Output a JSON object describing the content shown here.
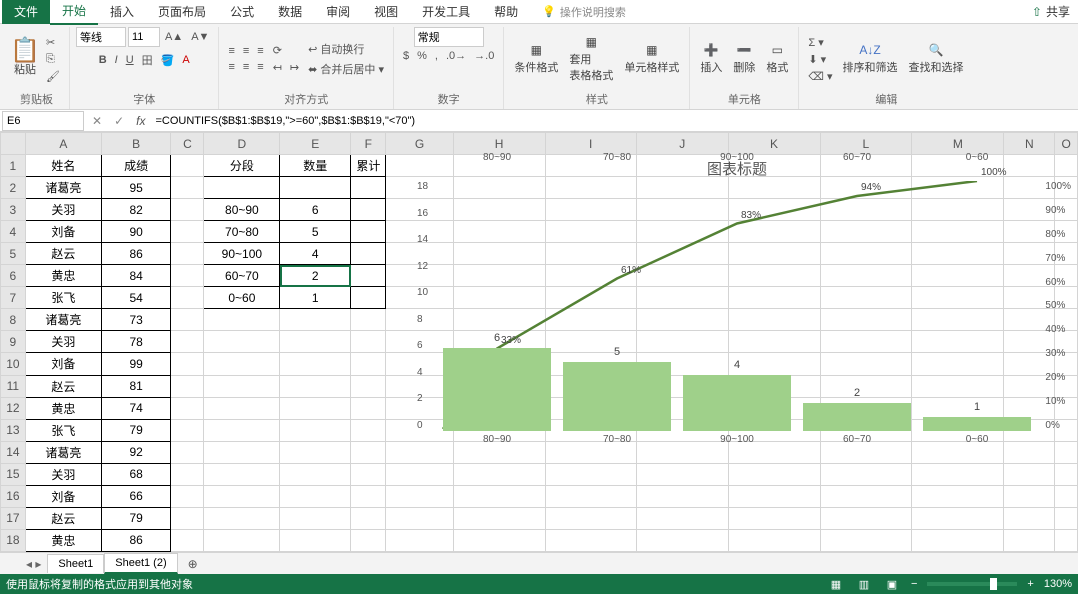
{
  "tabs": {
    "file": "文件",
    "items": [
      "开始",
      "插入",
      "页面布局",
      "公式",
      "数据",
      "审阅",
      "视图",
      "开发工具",
      "帮助"
    ],
    "tellme": "操作说明搜索",
    "share": "共享"
  },
  "ribbon": {
    "clipboard": {
      "paste": "粘贴",
      "label": "剪贴板"
    },
    "font": {
      "name": "等线",
      "size": "11",
      "label": "字体"
    },
    "align": {
      "wrap": "自动换行",
      "merge": "合并后居中",
      "label": "对齐方式"
    },
    "number": {
      "format": "常规",
      "label": "数字"
    },
    "styles": {
      "cond": "条件格式",
      "table": "套用\n表格格式",
      "cell": "单元格样式",
      "label": "样式"
    },
    "cells": {
      "insert": "插入",
      "delete": "删除",
      "format": "格式",
      "label": "单元格"
    },
    "editing": {
      "sort": "排序和筛选",
      "find": "查找和选择",
      "label": "编辑"
    }
  },
  "formula": {
    "cell": "E6",
    "text": "=COUNTIFS($B$1:$B$19,\">=60\",$B$1:$B$19,\"<70\")"
  },
  "columns": [
    "A",
    "B",
    "C",
    "D",
    "E",
    "F",
    "G",
    "H",
    "I",
    "J",
    "K",
    "L",
    "M",
    "N",
    "O"
  ],
  "headerRow": {
    "A": "姓名",
    "B": "成绩",
    "D": "分段",
    "E": "数量",
    "F": "累计"
  },
  "data": [
    {
      "A": "诸葛亮",
      "B": "95"
    },
    {
      "A": "关羽",
      "B": "82",
      "D": "80~90",
      "E": "6"
    },
    {
      "A": "刘备",
      "B": "90",
      "D": "70~80",
      "E": "5"
    },
    {
      "A": "赵云",
      "B": "86",
      "D": "90~100",
      "E": "4"
    },
    {
      "A": "黄忠",
      "B": "84",
      "D": "60~70",
      "E": "2"
    },
    {
      "A": "张飞",
      "B": "54",
      "D": "0~60",
      "E": "1"
    },
    {
      "A": "诸葛亮",
      "B": "73"
    },
    {
      "A": "关羽",
      "B": "78"
    },
    {
      "A": "刘备",
      "B": "99"
    },
    {
      "A": "赵云",
      "B": "81"
    },
    {
      "A": "黄忠",
      "B": "74"
    },
    {
      "A": "张飞",
      "B": "79"
    },
    {
      "A": "诸葛亮",
      "B": "92"
    },
    {
      "A": "关羽",
      "B": "68"
    },
    {
      "A": "刘备",
      "B": "66"
    },
    {
      "A": "赵云",
      "B": "79"
    },
    {
      "A": "黄忠",
      "B": "86"
    }
  ],
  "sheets": {
    "s1": "Sheet1",
    "s2": "Sheet1 (2)"
  },
  "status": {
    "msg": "使用鼠标将复制的格式应用到其他对象",
    "zoom": "130%"
  },
  "chart_data": {
    "type": "bar+line",
    "title": "图表标题",
    "categories": [
      "80~90",
      "70~80",
      "90~100",
      "60~70",
      "0~60"
    ],
    "series": [
      {
        "name": "数量",
        "type": "bar",
        "values": [
          6,
          5,
          4,
          2,
          1
        ]
      },
      {
        "name": "累计",
        "type": "line",
        "values": [
          33,
          61,
          83,
          94,
          100
        ],
        "unit": "%"
      }
    ],
    "ylim": [
      0,
      18
    ],
    "yticks": [
      0,
      2,
      4,
      6,
      8,
      10,
      12,
      14,
      16,
      18
    ],
    "y2lim": [
      0,
      100
    ],
    "y2ticks": [
      "0%",
      "10%",
      "20%",
      "30%",
      "40%",
      "50%",
      "60%",
      "70%",
      "80%",
      "90%",
      "100%"
    ],
    "xlabel": "",
    "ylabel": ""
  }
}
